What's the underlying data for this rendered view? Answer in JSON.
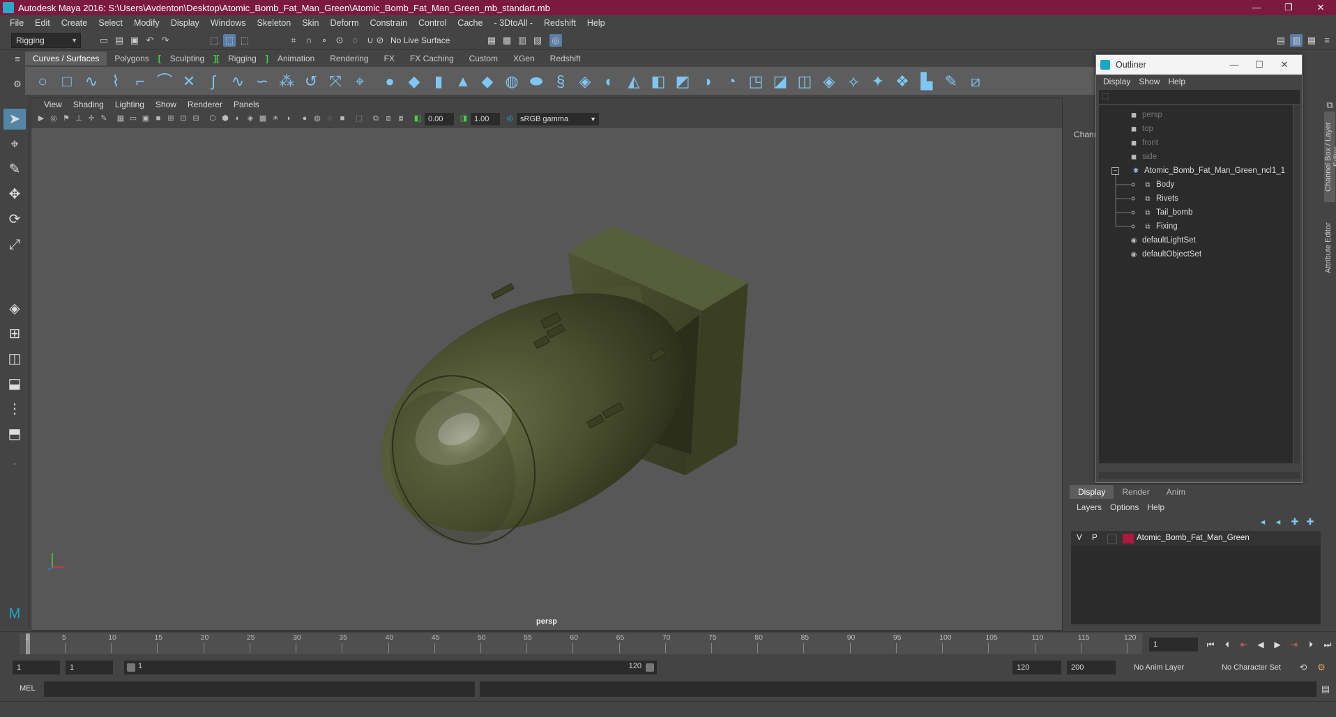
{
  "app": {
    "title": "Autodesk Maya 2016: S:\\Users\\Avdenton\\Desktop\\Atomic_Bomb_Fat_Man_Green\\Atomic_Bomb_Fat_Man_Green_mb_standart.mb",
    "minimize": "—",
    "maximize": "❐",
    "close": "✕"
  },
  "menu": [
    "File",
    "Edit",
    "Create",
    "Select",
    "Modify",
    "Display",
    "Windows",
    "Skeleton",
    "Skin",
    "Deform",
    "Constrain",
    "Control",
    "Cache",
    "- 3DtoAll -",
    "Redshift",
    "Help"
  ],
  "statusline": {
    "mode": "Rigging",
    "live_surface": "No Live Surface"
  },
  "shelf": {
    "tabs": [
      "Curves / Surfaces",
      "Polygons",
      "Sculpting",
      "Rigging",
      "Animation",
      "Rendering",
      "FX",
      "FX Caching",
      "Custom",
      "XGen",
      "Redshift"
    ],
    "active_tab": "Curves / Surfaces"
  },
  "viewport": {
    "menu": [
      "View",
      "Shading",
      "Lighting",
      "Show",
      "Renderer",
      "Panels"
    ],
    "exposure": "0.00",
    "gamma": "1.00",
    "color_space": "sRGB gamma",
    "camera": "persp"
  },
  "channel_box": {
    "label": "Chann"
  },
  "side_tabs": {
    "channel": "Channel Box / Layer Editor",
    "attribute": "Attribute Editor"
  },
  "outliner": {
    "title": "Outliner",
    "menu": [
      "Display",
      "Show",
      "Help"
    ],
    "items": [
      {
        "label": "persp",
        "icon": "camera-icon",
        "dim": true
      },
      {
        "label": "top",
        "icon": "camera-icon",
        "dim": true
      },
      {
        "label": "front",
        "icon": "camera-icon",
        "dim": true
      },
      {
        "label": "side",
        "icon": "camera-icon",
        "dim": true
      },
      {
        "label": "Atomic_Bomb_Fat_Man_Green_ncl1_1",
        "icon": "group-icon",
        "dim": false
      },
      {
        "label": "Body",
        "icon": "mesh-icon",
        "dim": false
      },
      {
        "label": "Rivets",
        "icon": "mesh-icon",
        "dim": false
      },
      {
        "label": "Tail_bomb",
        "icon": "mesh-icon",
        "dim": false
      },
      {
        "label": "Fixing",
        "icon": "mesh-icon",
        "dim": false
      },
      {
        "label": "defaultLightSet",
        "icon": "set-icon",
        "dim": false
      },
      {
        "label": "defaultObjectSet",
        "icon": "set-icon",
        "dim": false
      }
    ]
  },
  "layer_editor": {
    "tabs": [
      "Display",
      "Render",
      "Anim"
    ],
    "active_tab": "Display",
    "menu": [
      "Layers",
      "Options",
      "Help"
    ],
    "layer": {
      "v": "V",
      "p": "P",
      "name": "Atomic_Bomb_Fat_Man_Green",
      "color": "#b0183c"
    }
  },
  "timeline": {
    "ticks": [
      "1",
      "5",
      "10",
      "15",
      "20",
      "25",
      "30",
      "35",
      "40",
      "45",
      "50",
      "55",
      "60",
      "65",
      "70",
      "75",
      "80",
      "85",
      "90",
      "95",
      "100",
      "105",
      "110",
      "115",
      "120"
    ],
    "current_frame": "1"
  },
  "range": {
    "start": "1",
    "playback_start": "1",
    "slider_start": "1",
    "slider_end": "120",
    "playback_end": "120",
    "end": "200",
    "anim_layer": "No Anim Layer",
    "character_set": "No Character Set"
  },
  "cmdline": {
    "label": "MEL"
  },
  "colors": {
    "title_bar": "#7a1a3f",
    "bomb": "#4a5030",
    "accent": "#5285a6"
  }
}
